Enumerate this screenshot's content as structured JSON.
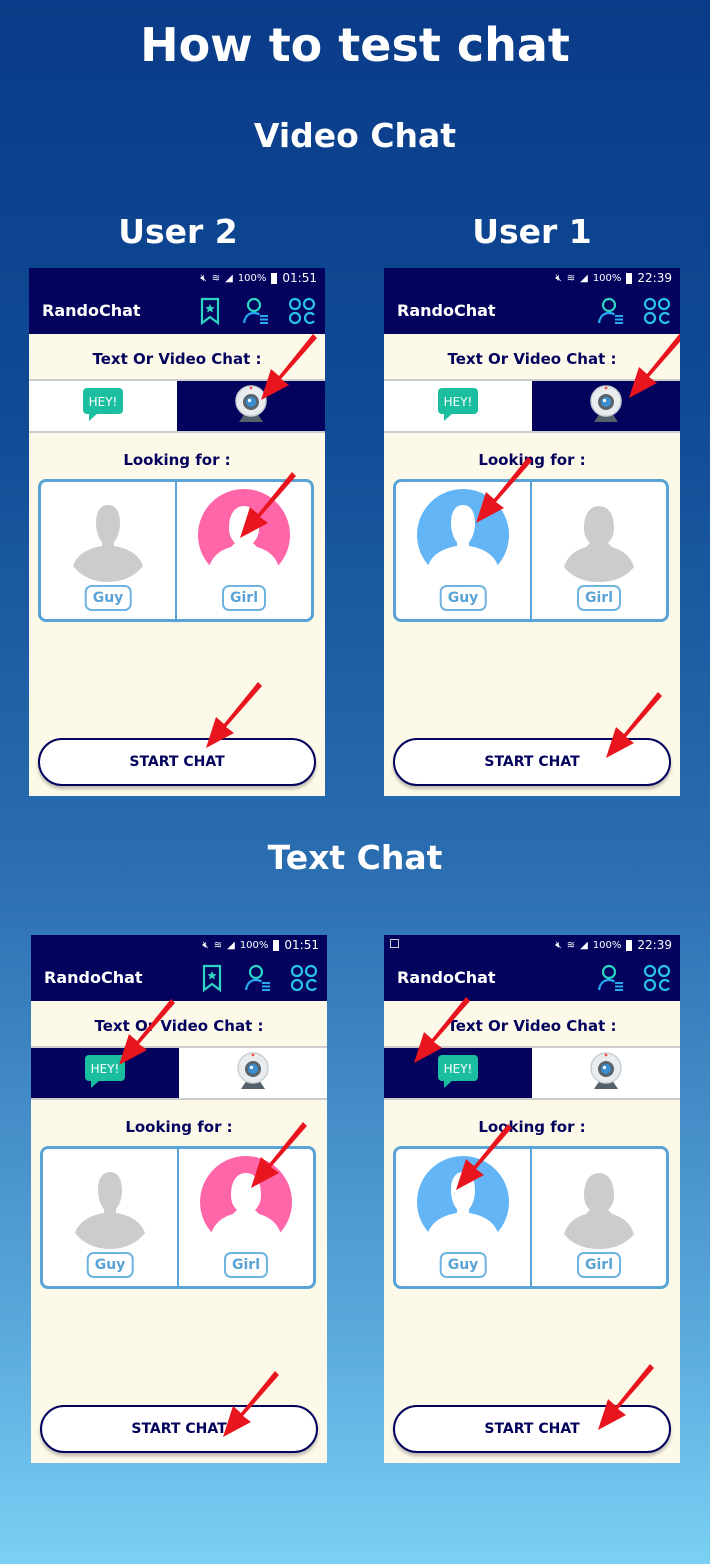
{
  "page": {
    "title": "How to test chat",
    "video_section_title": "Video Chat",
    "text_section_title": "Text Chat",
    "user_labels": {
      "left": "User 2",
      "right": "User 1"
    }
  },
  "colors": {
    "app_bar": "#03035e",
    "accent_blue": "#5aa3d6",
    "girl_pink": "#ff66aa",
    "guy_blue": "#64b5f6",
    "arrow_red": "#e8141e"
  },
  "phones": [
    {
      "id": "video-user2",
      "status": {
        "battery": "100%",
        "time": "01:51",
        "gallery_notice": false
      },
      "app_name": "RandoChat",
      "icons": [
        "bookmark-star-icon",
        "user-list-icon",
        "apps-grid-icon"
      ],
      "chat_type_label": "Text Or Video Chat :",
      "chat_type_options": [
        {
          "id": "text",
          "label": "HEY!",
          "selected": false
        },
        {
          "id": "video",
          "selected": true
        }
      ],
      "looking_for_label": "Looking for :",
      "genders": [
        {
          "label": "Guy",
          "selected": false
        },
        {
          "label": "Girl",
          "selected": true
        }
      ],
      "start_label": "START CHAT"
    },
    {
      "id": "video-user1",
      "status": {
        "battery": "100%",
        "time": "22:39",
        "gallery_notice": false
      },
      "app_name": "RandoChat",
      "icons": [
        "user-list-icon",
        "apps-grid-icon"
      ],
      "chat_type_label": "Text Or Video Chat :",
      "chat_type_options": [
        {
          "id": "text",
          "label": "HEY!",
          "selected": false
        },
        {
          "id": "video",
          "selected": true
        }
      ],
      "looking_for_label": "Looking for :",
      "genders": [
        {
          "label": "Guy",
          "selected": true
        },
        {
          "label": "Girl",
          "selected": false
        }
      ],
      "start_label": "START CHAT"
    },
    {
      "id": "text-user2",
      "status": {
        "battery": "100%",
        "time": "01:51",
        "gallery_notice": false
      },
      "app_name": "RandoChat",
      "icons": [
        "bookmark-star-icon",
        "user-list-icon",
        "apps-grid-icon"
      ],
      "chat_type_label": "Text Or Video Chat :",
      "chat_type_options": [
        {
          "id": "text",
          "label": "HEY!",
          "selected": true
        },
        {
          "id": "video",
          "selected": false
        }
      ],
      "looking_for_label": "Looking for :",
      "genders": [
        {
          "label": "Guy",
          "selected": false
        },
        {
          "label": "Girl",
          "selected": true
        }
      ],
      "start_label": "START CHAT"
    },
    {
      "id": "text-user1",
      "status": {
        "battery": "100%",
        "time": "22:39",
        "gallery_notice": true
      },
      "app_name": "RandoChat",
      "icons": [
        "user-list-icon",
        "apps-grid-icon"
      ],
      "chat_type_label": "Text Or Video Chat :",
      "chat_type_options": [
        {
          "id": "text",
          "label": "HEY!",
          "selected": true
        },
        {
          "id": "video",
          "selected": false
        }
      ],
      "looking_for_label": "Looking for :",
      "genders": [
        {
          "label": "Guy",
          "selected": true
        },
        {
          "label": "Girl",
          "selected": false
        }
      ],
      "start_label": "START CHAT"
    }
  ]
}
